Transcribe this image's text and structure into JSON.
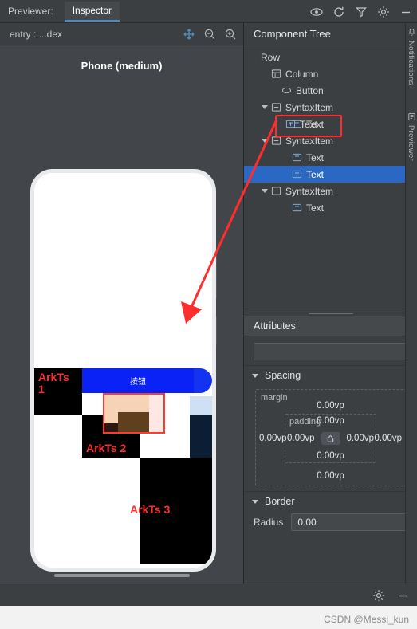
{
  "topbar": {
    "previewer_label": "Previewer:",
    "inspector_tab": "Inspector",
    "icons": [
      "eye-icon",
      "refresh-icon",
      "filter-icon",
      "gear-icon",
      "minimize-icon"
    ]
  },
  "left_header": {
    "entry_label": "entry : ...dex",
    "icons": [
      "move-icon",
      "zoom-out-icon",
      "zoom-in-icon"
    ]
  },
  "preview": {
    "device_title": "Phone (medium)",
    "labels": [
      {
        "text": "ArkTs\n1"
      },
      {
        "text": "ArkTs 2"
      },
      {
        "text": "ArkTs 3"
      }
    ],
    "button_text": "按钮"
  },
  "component_tree": {
    "title": "Component Tree",
    "nodes": [
      {
        "label": "Row",
        "indent": 0,
        "icon": "none",
        "arrow": false,
        "selected": false
      },
      {
        "label": "Column",
        "indent": 1,
        "icon": "layout-icon",
        "arrow": false,
        "selected": false
      },
      {
        "label": "Button",
        "indent": 2,
        "icon": "button-icon",
        "arrow": false,
        "selected": false
      },
      {
        "label": "SyntaxItem",
        "indent": 1,
        "icon": "syntax-icon",
        "arrow": true,
        "selected": false
      },
      {
        "label": "Text",
        "indent": 3,
        "icon": "text-icon",
        "arrow": false,
        "selected": false
      },
      {
        "label": "SyntaxItem",
        "indent": 1,
        "icon": "syntax-icon",
        "arrow": true,
        "selected": false
      },
      {
        "label": "Text",
        "indent": 3,
        "icon": "text-icon",
        "arrow": false,
        "selected": false
      },
      {
        "label": "Text",
        "indent": 3,
        "icon": "text-icon",
        "arrow": false,
        "selected": true
      },
      {
        "label": "SyntaxItem",
        "indent": 1,
        "icon": "syntax-icon",
        "arrow": true,
        "selected": false
      },
      {
        "label": "Text",
        "indent": 3,
        "icon": "text-icon",
        "arrow": false,
        "selected": false
      }
    ],
    "callout_node_label": "Text"
  },
  "attributes": {
    "title": "Attributes",
    "search_value": "",
    "spacing": {
      "title": "Spacing",
      "margin_label": "margin",
      "padding_label": "padding",
      "margin_top": "0.00vp",
      "margin_left": "0.00vp",
      "margin_right": "0.00vp",
      "margin_bottom": "0.00vp",
      "padding_top": "0.00vp",
      "padding_left": "0.00vp",
      "padding_right": "0.00vp",
      "padding_bottom": "0.00vp",
      "lock_icon": "lock-icon"
    },
    "border": {
      "title": "Border",
      "radius_label": "Radius",
      "radius_value": "0.00"
    }
  },
  "bottombar": {
    "icons": [
      "gear-icon",
      "minimize-icon"
    ]
  },
  "rail": {
    "notifications": "Notifications",
    "previewer": "Previewer"
  },
  "watermark": "CSDN @Messi_kun",
  "colors": {
    "accent_selection": "#2b68c4",
    "callout_red": "#ff2d2d",
    "panel_bg": "#3c3f41",
    "preview_bg": "#42464a",
    "button_blue": "#0a22f5"
  }
}
